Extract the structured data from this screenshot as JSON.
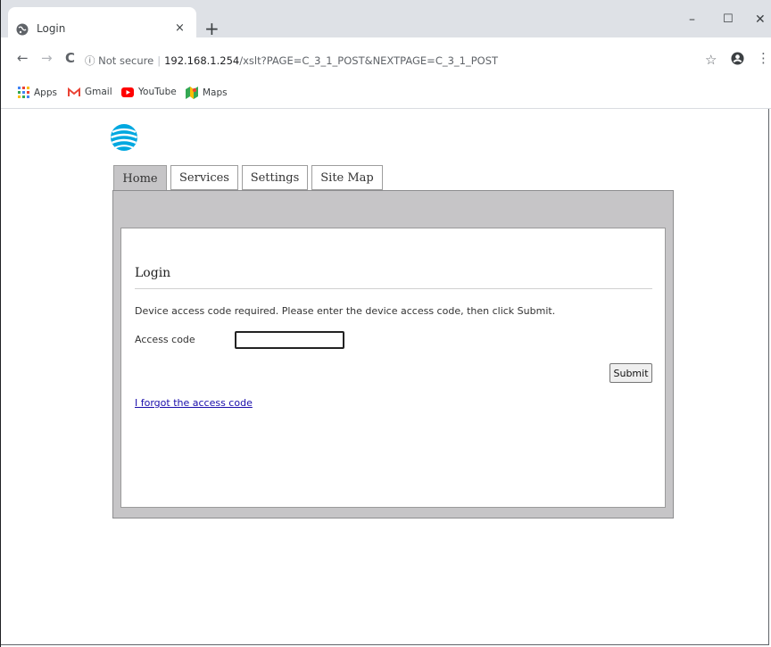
{
  "browser": {
    "tab_title": "Login",
    "tab_close": "×",
    "new_tab": "+",
    "window_controls": {
      "minimize": "–",
      "maximize": "☐",
      "close": "✕"
    },
    "nav": {
      "back": "←",
      "forward": "→",
      "reload": "C"
    },
    "address": {
      "security_icon": "ⓘ",
      "security_label": "Not secure",
      "separator": "|",
      "host": "192.168.1.254",
      "path": "/xslt?PAGE=C_3_1_POST&NEXTPAGE=C_3_1_POST"
    },
    "star": "☆",
    "menu": "⋮",
    "icons": [
      "globe-icon",
      "info-icon",
      "star-icon",
      "profile-icon",
      "menu-dots-icon",
      "apps-grid-icon",
      "gmail-icon",
      "youtube-icon",
      "maps-icon"
    ]
  },
  "bookmarks": [
    {
      "label": "Apps",
      "icon": "apps-grid-icon"
    },
    {
      "label": "Gmail",
      "icon": "gmail-icon"
    },
    {
      "label": "YouTube",
      "icon": "youtube-icon"
    },
    {
      "label": "Maps",
      "icon": "maps-icon"
    }
  ],
  "page": {
    "tabs": [
      {
        "label": "Home",
        "active": true
      },
      {
        "label": "Services"
      },
      {
        "label": "Settings"
      },
      {
        "label": "Site Map"
      }
    ],
    "login": {
      "heading": "Login",
      "message": "Device access code required. Please enter the device access code, then click Submit.",
      "access_code_label": "Access code",
      "access_code_value": "",
      "submit_label": "Submit",
      "forgot_link": "I forgot the access code"
    }
  },
  "colors": {
    "tabstrip": "#dee1e6",
    "panel_gray": "#c6c5c7",
    "link": "#1a0dab",
    "att_blue": "#00a8e0"
  }
}
